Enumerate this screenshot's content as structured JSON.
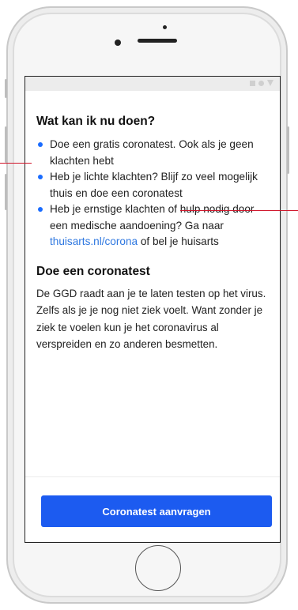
{
  "colors": {
    "accent": "#1c5bf0",
    "link": "#2f78e0",
    "bullet": "#1a6cff",
    "annotation": "#d0162b"
  },
  "section1": {
    "title": "Wat kan ik nu doen?",
    "bullets": [
      {
        "text": "Doe een gratis coronatest. Ook als je geen klachten hebt"
      },
      {
        "text": "Heb je lichte klachten? Blijf zo veel mogelijk thuis en doe een coronatest"
      },
      {
        "text_before": "Heb je ernstige klachten of hulp nodig door een medische aandoening? Ga naar ",
        "link": "thuisarts.nl/corona",
        "text_after": " of bel je huisarts"
      }
    ]
  },
  "section2": {
    "title": "Doe een coronatest",
    "body": "De GGD raadt aan je te laten testen op het virus. Zelfs als je je nog niet ziek voelt. Want zonder je ziek te voelen kun je het coronavirus al verspreiden en zo anderen besmetten."
  },
  "cta": {
    "label": "Coronatest aanvragen"
  },
  "status_icons": [
    "square-icon",
    "circle-icon",
    "triangle-icon"
  ]
}
